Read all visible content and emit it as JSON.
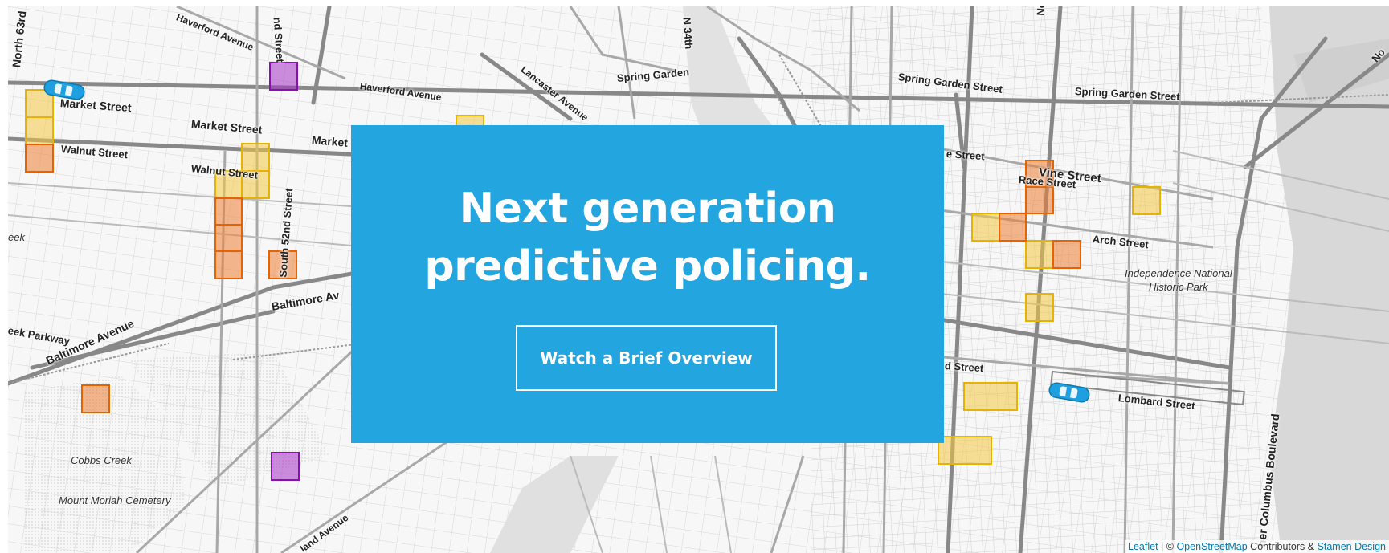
{
  "hero": {
    "title_line1": "Next generation",
    "title_line2": "predictive policing.",
    "button_label": "Watch a Brief Overview"
  },
  "attribution": {
    "leaflet": "Leaflet",
    "separator": " | © ",
    "osm": "OpenStreetMap",
    "contributors": " Contributors & ",
    "stamen": "Stamen Design"
  },
  "map_labels": [
    {
      "text": "North 63rd",
      "name": "label-north-63rd"
    },
    {
      "text": "Haverford Avenue",
      "name": "label-haverford-avenue-west"
    },
    {
      "text": "nd Street",
      "name": "label-nd-street-north"
    },
    {
      "text": "N 34th",
      "name": "label-n-34th"
    },
    {
      "text": "Nor",
      "name": "label-nor"
    },
    {
      "text": "No",
      "name": "label-no"
    },
    {
      "text": "Market Street",
      "name": "label-market-street-1"
    },
    {
      "text": "Market Street",
      "name": "label-market-street-2"
    },
    {
      "text": "Market",
      "name": "label-market-3"
    },
    {
      "text": "Haverford Avenue",
      "name": "label-haverford-avenue-east"
    },
    {
      "text": "Lancaster Avenue",
      "name": "label-lancaster-avenue"
    },
    {
      "text": "Spring Garden",
      "name": "label-spring-garden"
    },
    {
      "text": "Spring Garden Street",
      "name": "label-spring-garden-street-1"
    },
    {
      "text": "Spring Garden Street",
      "name": "label-spring-garden-street-2"
    },
    {
      "text": "Walnut Street",
      "name": "label-walnut-street-1"
    },
    {
      "text": "Walnut Street",
      "name": "label-walnut-street-2"
    },
    {
      "text": "South 52nd Street",
      "name": "label-south-52nd-street"
    },
    {
      "text": "e Street",
      "name": "label-e-street"
    },
    {
      "text": "Vine Street",
      "name": "label-vine-street"
    },
    {
      "text": "Race Street",
      "name": "label-race-street"
    },
    {
      "text": "Arch Street",
      "name": "label-arch-street"
    },
    {
      "text": "Independence National",
      "name": "label-independence-1"
    },
    {
      "text": "Historic Park",
      "name": "label-independence-2"
    },
    {
      "text": "eek",
      "name": "label-eek"
    },
    {
      "text": "Baltimore Av",
      "name": "label-baltimore-av"
    },
    {
      "text": "eek Parkway",
      "name": "label-eek-parkway"
    },
    {
      "text": "Baltimore Avenue",
      "name": "label-baltimore-avenue"
    },
    {
      "text": "d Street",
      "name": "label-d-street"
    },
    {
      "text": "Lombard Street",
      "name": "label-lombard-street"
    },
    {
      "text": "Cobbs Creek",
      "name": "label-cobbs-creek"
    },
    {
      "text": "Mount Moriah Cemetery",
      "name": "label-mount-moriah"
    },
    {
      "text": "land Avenue",
      "name": "label-land-avenue"
    },
    {
      "text": "her Columbus Boulevard",
      "name": "label-columbus-boulevard"
    }
  ],
  "colors": {
    "hero_bg": "#23a5df",
    "risk_low": "#f5c843",
    "risk_medium": "#ee7d33",
    "risk_high": "#a633c9",
    "car": "#1e9fe0"
  },
  "icons": [
    "patrol-car-icon"
  ]
}
